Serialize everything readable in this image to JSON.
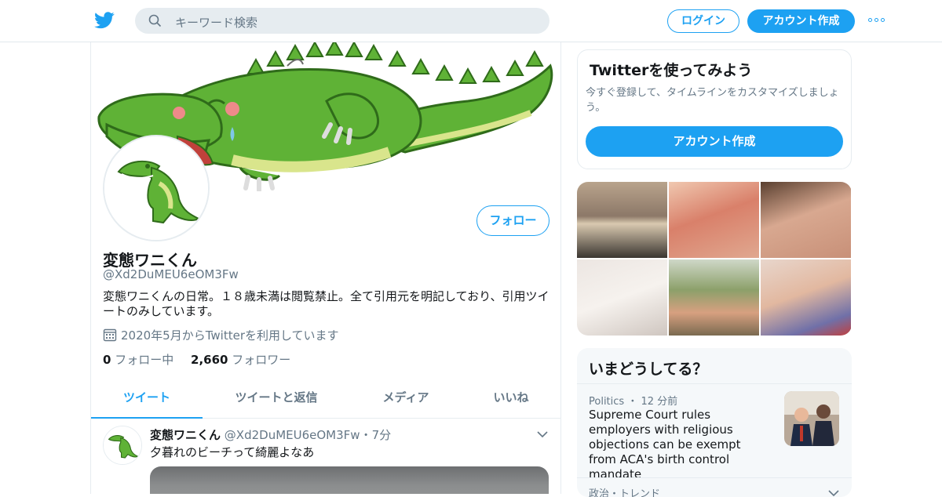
{
  "header": {
    "search_placeholder": "キーワード検索",
    "login_label": "ログイン",
    "signup_label": "アカウント作成",
    "accent_color": "#1da1f2"
  },
  "profile": {
    "follow_label": "フォロー",
    "name": "変態ワニくん",
    "handle": "@Xd2DuMEU6eOM3Fw",
    "bio": "変態ワニくんの日常。１８歳未満は閲覧禁止。全て引用元を明記しており、引用ツイートのみしています。",
    "joined": "2020年5月からTwitterを利用しています",
    "following_count": "0",
    "following_label": "フォロー中",
    "followers_count": "2,660",
    "followers_label": "フォロワー"
  },
  "tabs": [
    {
      "label": "ツイート",
      "active": true
    },
    {
      "label": "ツイートと返信"
    },
    {
      "label": "メディア"
    },
    {
      "label": "いいね"
    }
  ],
  "tweet": {
    "name": "変態ワニくん",
    "handle": "@Xd2DuMEU6eOM3Fw",
    "separator": "・",
    "time": "7分",
    "text": "夕暮れのビーチって綺麗よなあ"
  },
  "signup_card": {
    "title": "Twitterを使ってみよう",
    "description": "今すぐ登録して、タイムラインをカスタマイズしましょう。",
    "button_label": "アカウント作成"
  },
  "trends": {
    "title": "いまどうしてる？",
    "item_meta": "Politics ・ 12 分前",
    "item_headline": "Supreme Court rules employers with religious objections can be exempt from ACA's birth control mandate",
    "item2_meta": "政治・トレンド"
  }
}
